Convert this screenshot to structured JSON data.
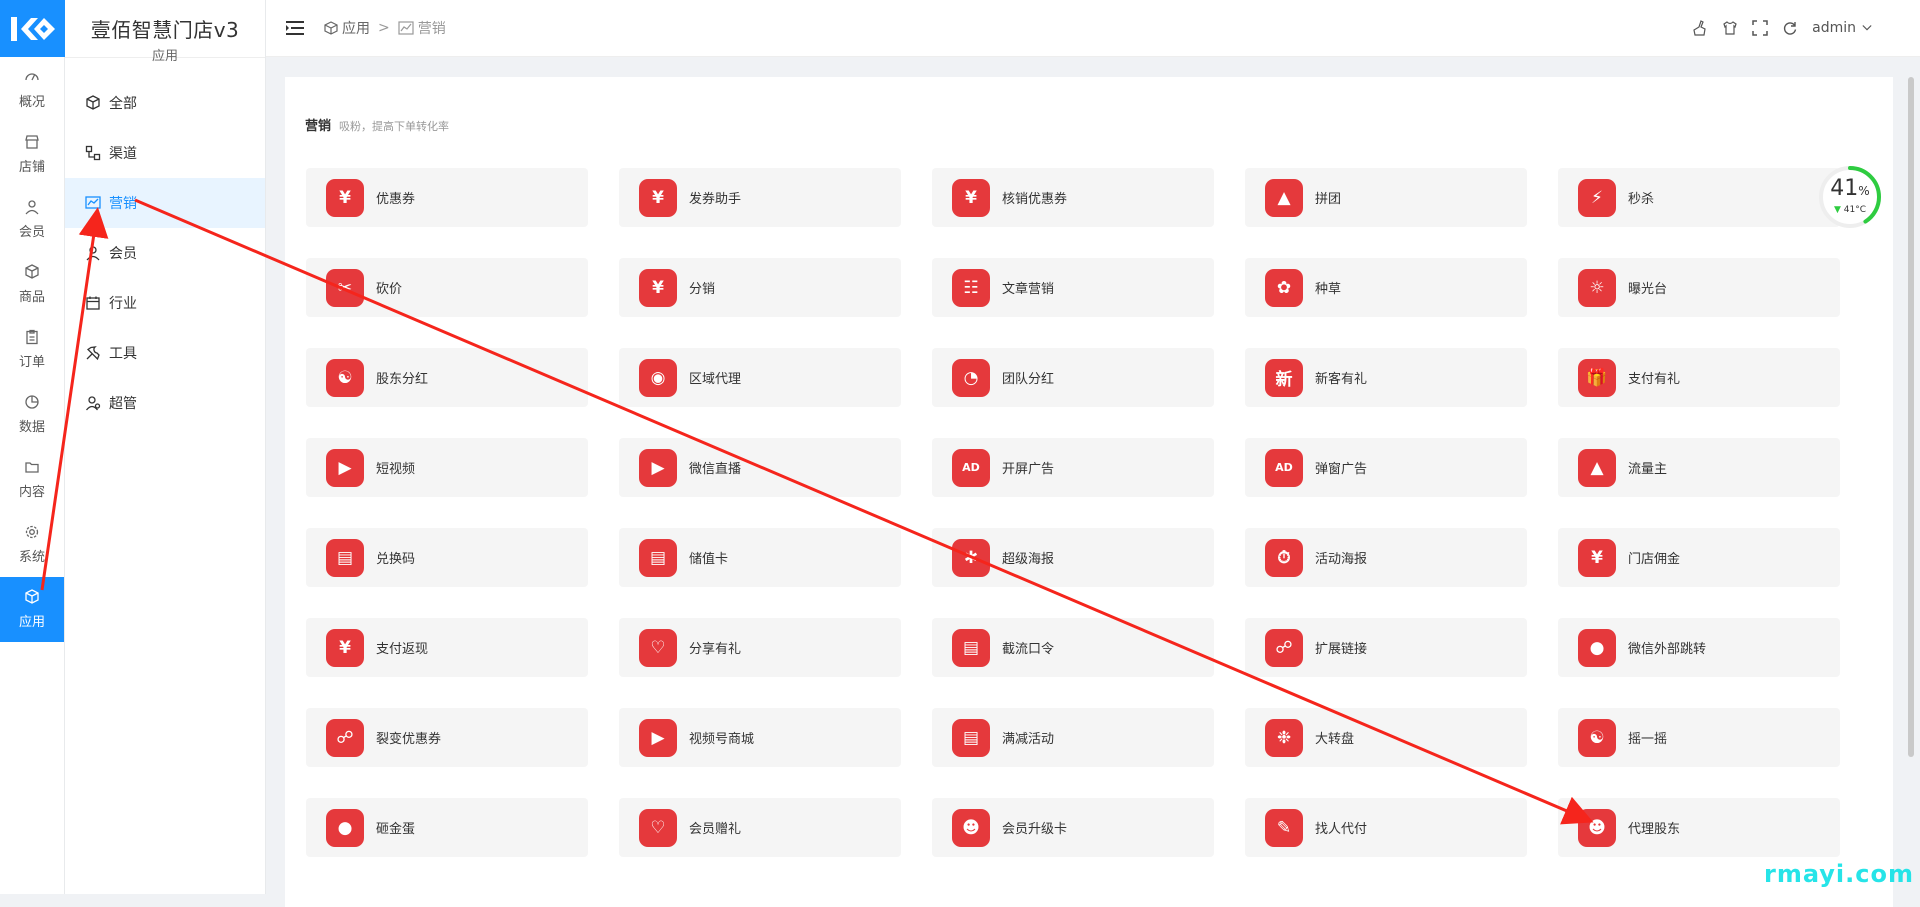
{
  "brand": {
    "name": "壹佰智慧门店v3",
    "sub": "应用"
  },
  "iconbar": [
    {
      "label": "概况",
      "icon": "gauge-icon"
    },
    {
      "label": "店铺",
      "icon": "store-icon"
    },
    {
      "label": "会员",
      "icon": "user-icon"
    },
    {
      "label": "商品",
      "icon": "cube-icon"
    },
    {
      "label": "订单",
      "icon": "clipboard-icon"
    },
    {
      "label": "数据",
      "icon": "pie-icon"
    },
    {
      "label": "内容",
      "icon": "folder-icon"
    },
    {
      "label": "系统",
      "icon": "gear-icon"
    },
    {
      "label": "应用",
      "icon": "cube-icon",
      "active": true
    }
  ],
  "subbar": [
    {
      "label": "全部",
      "icon": "cube-icon"
    },
    {
      "label": "渠道",
      "icon": "channel-icon"
    },
    {
      "label": "营销",
      "icon": "chart-icon",
      "active": true
    },
    {
      "label": "会员",
      "icon": "user-icon"
    },
    {
      "label": "行业",
      "icon": "calendar-icon"
    },
    {
      "label": "工具",
      "icon": "wrench-icon"
    },
    {
      "label": "超管",
      "icon": "admin-icon"
    }
  ],
  "breadcrumb": {
    "first": "应用",
    "separator": ">",
    "second": "营销"
  },
  "header": {
    "user": "admin"
  },
  "section": {
    "title": "营销",
    "subtitle": "吸粉，提高下单转化率"
  },
  "apps": [
    "优惠券",
    "发券助手",
    "核销优惠券",
    "拼团",
    "秒杀",
    "砍价",
    "分销",
    "文章营销",
    "种草",
    "曝光台",
    "股东分红",
    "区域代理",
    "团队分红",
    "新客有礼",
    "支付有礼",
    "短视频",
    "微信直播",
    "开屏广告",
    "弹窗广告",
    "流量主",
    "兑换码",
    "储值卡",
    "超级海报",
    "活动海报",
    "门店佣金",
    "支付返现",
    "分享有礼",
    "截流口令",
    "扩展链接",
    "微信外部跳转",
    "裂变优惠券",
    "视频号商城",
    "满减活动",
    "大转盘",
    "摇一摇",
    "砸金蛋",
    "会员赠礼",
    "会员升级卡",
    "找人代付",
    "代理股东"
  ],
  "gauge": {
    "value": "41",
    "unit": "%",
    "temp": "41°C"
  },
  "watermark": "rmayi.com",
  "colors": {
    "accent": "#1890ff",
    "appIcon": "#e5393c",
    "arrow": "#f5251c"
  }
}
